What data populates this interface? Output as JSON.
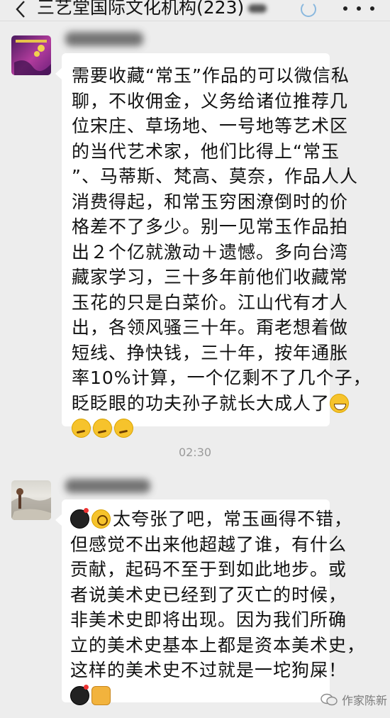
{
  "header": {
    "title": "三艺堂国际文化机构(223)",
    "back_icon": "chevron-left-icon",
    "spinner_icon": "loading-ring-icon",
    "more_icon": "more-dots-icon"
  },
  "messages": [
    {
      "lines": [
        "需要收藏“常玉”作品的可以微信私",
        "聊，不收佣金，义务给诸位推荐几",
        "位宋庄、草场地、一号地等艺术区",
        "的当代艺术家，他们比得上“常玉",
        "”、马蒂斯、梵高、莫奈，作品人人",
        "消费得起，和常玉穷困潦倒时的价",
        "格差不了多少。别一见常玉作品拍",
        "出２个亿就激动＋遗憾。多向台湾",
        "藏家学习，三十多年前他们收藏常",
        "玉花的只是白菜价。江山代有才人",
        "出，各领风骚三十年。甭老想着做",
        "短线、挣快钱，三十年，按年通胀",
        "率10%计算，一个亿剩不了几个子，",
        "眨眨眼的功夫孙子就长大成人了"
      ]
    },
    {
      "first_line": "太夸张了吧，常玉画得不错，",
      "lines": [
        "但感觉不出来他超越了谁，有什么",
        "贡献，起码不至于到如此地步。或",
        "者说美术史已经到了灭亡的时候，",
        "非美术史即将出现。因为我们所确",
        "立的美术史基本上都是资本美术史，",
        "这样的美术史不过就是一坨狗屎！"
      ]
    }
  ],
  "timestamp": "02:30",
  "watermark": "作家陈新"
}
